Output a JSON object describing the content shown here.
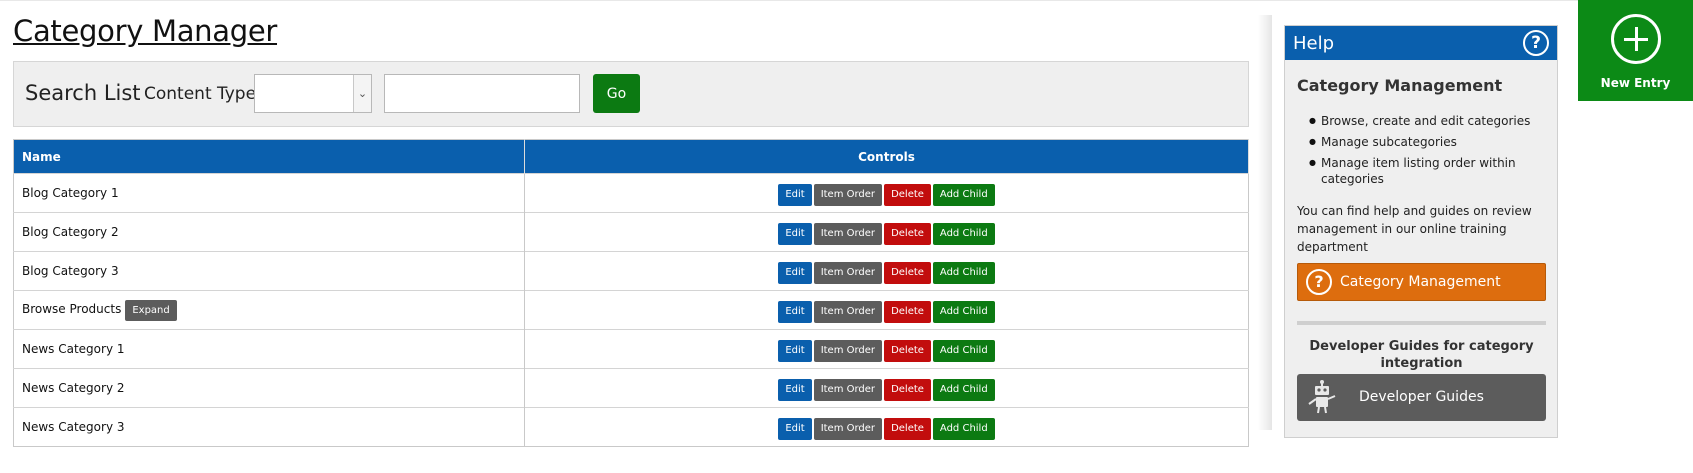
{
  "page": {
    "title": "Category Manager"
  },
  "search": {
    "label": "Search List",
    "content_type_label": "Content Type",
    "content_type_value": "",
    "query_value": "",
    "go_label": "Go"
  },
  "table": {
    "columns": [
      "Name",
      "Controls"
    ],
    "rows": [
      {
        "name": "Blog Category 1",
        "expand": null
      },
      {
        "name": "Blog Category 2",
        "expand": null
      },
      {
        "name": "Blog Category 3",
        "expand": null
      },
      {
        "name": "Browse Products",
        "expand": "Expand"
      },
      {
        "name": "News Category 1",
        "expand": null
      },
      {
        "name": "News Category 2",
        "expand": null
      },
      {
        "name": "News Category 3",
        "expand": null
      }
    ],
    "controls": {
      "edit": "Edit",
      "item_order": "Item Order",
      "delete": "Delete",
      "add_child": "Add Child"
    }
  },
  "help": {
    "title": "Help",
    "heading": "Category Management",
    "bullets": [
      "Browse, create and edit categories",
      "Manage subcategories",
      "Manage item listing order within categories"
    ],
    "text": "You can find help and guides on review management in our online training department",
    "training_button": "Category Management",
    "dev_heading": "Developer Guides for category integration",
    "dev_button": "Developer Guides",
    "icons": {
      "help": "question-circle-icon",
      "robot": "robot-icon"
    }
  },
  "new_entry": {
    "label": "New Entry",
    "icon": "plus-circle-icon"
  },
  "colors": {
    "primary_blue": "#0a5fad",
    "green": "#0c7a12",
    "new_entry_green": "#0c8a16",
    "red": "#c20d0d",
    "gray": "#5c5c5c",
    "orange": "#dd6d0e"
  }
}
